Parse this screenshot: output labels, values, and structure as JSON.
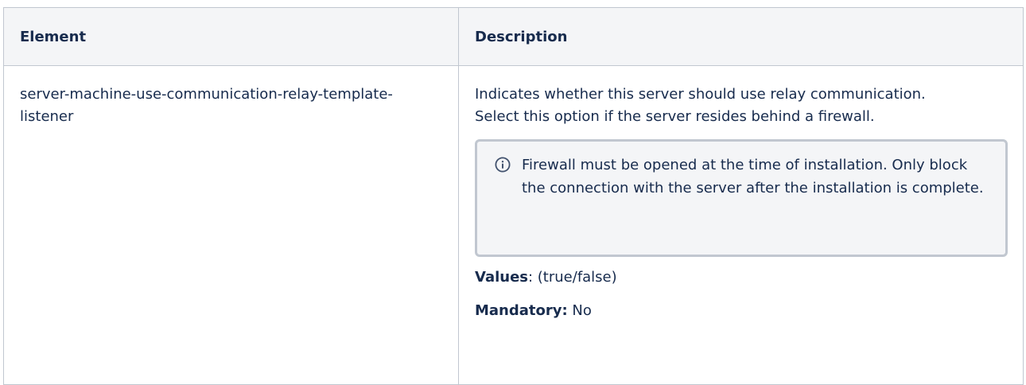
{
  "table": {
    "headers": {
      "element": "Element",
      "description": "Description"
    },
    "rows": [
      {
        "element": "server-machine-use-communication-relay-template-listener",
        "description": "Indicates whether this server should use relay communication. Select this option if the server resides behind a firewall.",
        "info_panel": {
          "icon": "info-icon",
          "text": "Firewall must be opened at the time of installation. Only block the connection with the server after the installation is complete."
        },
        "values_label": "Values",
        "values_text": ": (true/false)",
        "mandatory_label": "Mandatory:",
        "mandatory_text": " No"
      }
    ]
  }
}
